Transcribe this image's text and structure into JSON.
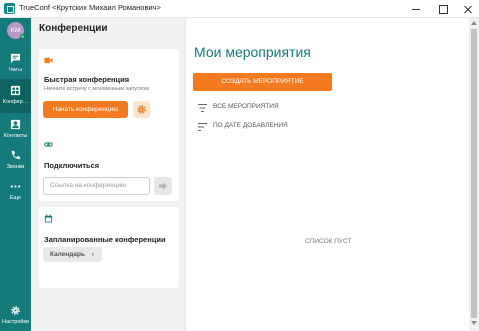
{
  "window": {
    "title": "TrueConf <Крутских Михаил Романович>",
    "icons": {
      "app": "trueconf-logo-icon",
      "minimize": "minimize-icon",
      "maximize": "maximize-icon",
      "close": "close-icon"
    }
  },
  "colors": {
    "brand": "#157a7a",
    "accent": "#f47a20",
    "presence_online": "#5fd36a"
  },
  "rail": {
    "avatar_initials": "KM",
    "avatar_status": "online",
    "items": [
      {
        "label": "Чаты",
        "icon": "chat-icon",
        "active": false
      },
      {
        "label": "Конфер…",
        "icon": "conferences-icon",
        "active": true
      },
      {
        "label": "Контакты",
        "icon": "contacts-icon",
        "active": false
      },
      {
        "label": "Звонки",
        "icon": "phone-icon",
        "active": false
      },
      {
        "label": "Еще",
        "icon": "more-icon",
        "active": false
      }
    ],
    "settings": {
      "label": "Настройки",
      "icon": "gear-icon"
    }
  },
  "conferences": {
    "title": "Конференции",
    "quick": {
      "icon": "video-camera-icon",
      "title": "Быстрая конференция",
      "subtitle": "Начните встречу с мгновенным запуском",
      "start_button": "Начать конференцию",
      "settings_icon": "gear-icon"
    },
    "join": {
      "icon": "link-icon",
      "title": "Подключиться",
      "input_placeholder": "Ссылка на конференцию",
      "go_icon": "arrow-right-icon"
    },
    "scheduled": {
      "icon": "calendar-icon",
      "title": "Запланированные конференции",
      "calendar_button": "Календарь",
      "chevron": "›"
    }
  },
  "main": {
    "title": "Мои мероприятия",
    "create_button": "СОЗДАТЬ МЕРОПРИЯТИЕ",
    "filters": [
      {
        "label": "ВСЕ МЕРОПРИЯТИЯ",
        "icon": "filter-icon"
      },
      {
        "label": "ПО ДАТЕ ДОБАВЛЕНИЯ",
        "icon": "sort-icon"
      }
    ],
    "empty_text": "СПИСОК ПУСТ"
  }
}
